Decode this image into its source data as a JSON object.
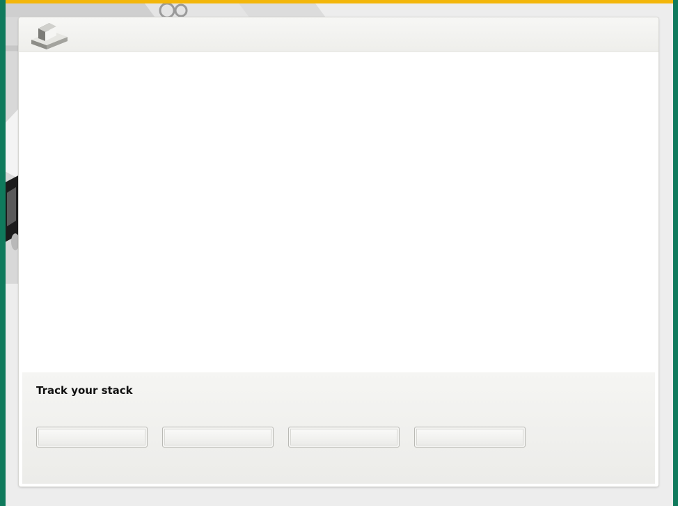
{
  "app": {
    "logo_icon": "gold-bars-icon"
  },
  "backdrop": {
    "accent_color": "#f3b60a",
    "outer_color": "#0f7a5c"
  },
  "tracker": {
    "title": "Track your stack",
    "fields": [
      {
        "value": "",
        "placeholder": ""
      },
      {
        "value": "",
        "placeholder": ""
      },
      {
        "value": "",
        "placeholder": ""
      },
      {
        "value": "",
        "placeholder": ""
      }
    ]
  }
}
